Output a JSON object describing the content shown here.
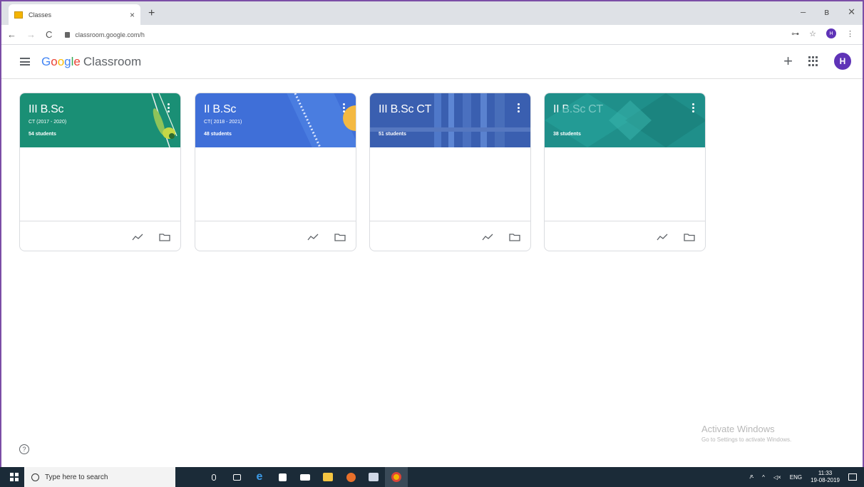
{
  "browser": {
    "tab_title": "Classes",
    "tab_close": "×",
    "new_tab": "+",
    "url": "classroom.google.com/h",
    "window_controls": {
      "minimize": "–",
      "restore": "ʙ",
      "close": "✕"
    }
  },
  "app": {
    "brand_google": [
      "G",
      "o",
      "o",
      "g",
      "l",
      "e"
    ],
    "brand_product": "Classroom",
    "add_button": "+",
    "avatar_initial": "H",
    "accent_color": "#5f33b7"
  },
  "classes": [
    {
      "title": "III B.Sc",
      "section": "CT (2017 - 2020)",
      "students": "54 students",
      "color": "#1a8f75"
    },
    {
      "title": "II B.Sc",
      "section": "CT( 2018 - 2021)",
      "students": "48 students",
      "color": "#3f6fd8"
    },
    {
      "title": "III B.Sc CT",
      "section": "",
      "students": "51 students",
      "color": "#3a5fb0"
    },
    {
      "title": "II B.Sc CT",
      "section": "",
      "students": "38 students",
      "color": "#1f8f8a"
    }
  ],
  "help_label": "?",
  "watermark": {
    "title": "Activate Windows",
    "subtitle": "Go to Settings to activate Windows."
  },
  "taskbar": {
    "search_placeholder": "Type here to search",
    "language": "ENG",
    "time": "11:33",
    "date": "19-08-2019"
  }
}
